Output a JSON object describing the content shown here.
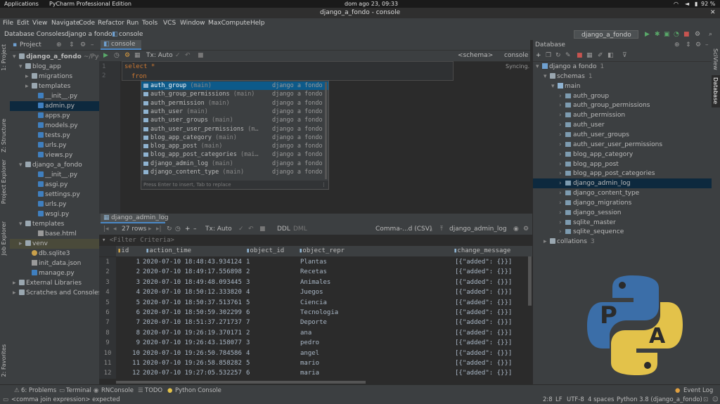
{
  "system": {
    "applications": "Applications",
    "app_name": "PyCharm Professional Edition",
    "clock": "dom ago 23, 09:33",
    "battery": "92 %"
  },
  "window": {
    "title": "django_a_fondo - console"
  },
  "menu": [
    "File",
    "Edit",
    "View",
    "Navigate",
    "Code",
    "Refactor",
    "Run",
    "Tools",
    "VCS",
    "Window",
    "MaxCompute",
    "Help"
  ],
  "breadcrumb": {
    "part1": "Database Consoles",
    "part2": "django a fondo",
    "part3": "console"
  },
  "run_config": "django_a_fondo",
  "project": {
    "header": "Project",
    "items": [
      {
        "label": "django_a_fondo",
        "extra": "~/Pycha",
        "indent": 0,
        "icon": "folder"
      },
      {
        "label": "blog_app",
        "indent": 1,
        "icon": "folder"
      },
      {
        "label": "migrations",
        "indent": 2,
        "icon": "folder"
      },
      {
        "label": "templates",
        "indent": 2,
        "icon": "folder"
      },
      {
        "label": "__init__.py",
        "indent": 3,
        "icon": "py"
      },
      {
        "label": "admin.py",
        "indent": 3,
        "icon": "py",
        "selected": true
      },
      {
        "label": "apps.py",
        "indent": 3,
        "icon": "py"
      },
      {
        "label": "models.py",
        "indent": 3,
        "icon": "py"
      },
      {
        "label": "tests.py",
        "indent": 3,
        "icon": "py"
      },
      {
        "label": "urls.py",
        "indent": 3,
        "icon": "py"
      },
      {
        "label": "views.py",
        "indent": 3,
        "icon": "py"
      },
      {
        "label": "django_a_fondo",
        "indent": 1,
        "icon": "folder"
      },
      {
        "label": "__init__.py",
        "indent": 3,
        "icon": "py"
      },
      {
        "label": "asgi.py",
        "indent": 3,
        "icon": "py"
      },
      {
        "label": "settings.py",
        "indent": 3,
        "icon": "py"
      },
      {
        "label": "urls.py",
        "indent": 3,
        "icon": "py"
      },
      {
        "label": "wsgi.py",
        "indent": 3,
        "icon": "py"
      },
      {
        "label": "templates",
        "indent": 1,
        "icon": "folder"
      },
      {
        "label": "base.html",
        "indent": 3,
        "icon": "file"
      },
      {
        "label": "venv",
        "indent": 1,
        "icon": "folder",
        "venv": true
      },
      {
        "label": "db.sqlite3",
        "indent": 2,
        "icon": "db"
      },
      {
        "label": "init_data.json",
        "indent": 2,
        "icon": "file"
      },
      {
        "label": "manage.py",
        "indent": 2,
        "icon": "py"
      },
      {
        "label": "External Libraries",
        "indent": 0,
        "icon": "folder"
      },
      {
        "label": "Scratches and Consoles",
        "indent": 0,
        "icon": "folder"
      }
    ]
  },
  "left_tabs": {
    "project": "1: Project",
    "structure": "Z: Structure",
    "project_explorer": "Project Explorer",
    "job_explorer": "Job Explorer",
    "favorites": "2: Favorites"
  },
  "editor": {
    "tab": "console",
    "tx": "Tx: Auto",
    "schema": "<schema>",
    "console": "console",
    "syncing": "Syncing...",
    "lines": [
      {
        "num": "1",
        "text": "select *"
      },
      {
        "num": "2",
        "text": "fron"
      }
    ]
  },
  "completion": {
    "items": [
      {
        "name": "auth_group",
        "schema": "(main)",
        "source": "django a fondo"
      },
      {
        "name": "auth_group_permissions",
        "schema": "(main)",
        "source": "django a fondo"
      },
      {
        "name": "auth_permission",
        "schema": "(main)",
        "source": "django a fondo"
      },
      {
        "name": "auth_user",
        "schema": "(main)",
        "source": "django a fondo"
      },
      {
        "name": "auth_user_groups",
        "schema": "(main)",
        "source": "django a fondo"
      },
      {
        "name": "auth_user_user_permissions",
        "schema": "(m…",
        "source": "django a fondo"
      },
      {
        "name": "blog_app_category",
        "schema": "(main)",
        "source": "django a fondo"
      },
      {
        "name": "blog_app_post",
        "schema": "(main)",
        "source": "django a fondo"
      },
      {
        "name": "blog_app_post_categories",
        "schema": "(mai…",
        "source": "django a fondo"
      },
      {
        "name": "django_admin_log",
        "schema": "(main)",
        "source": "django a fondo"
      },
      {
        "name": "django_content_type",
        "schema": "(main)",
        "source": "django a fondo"
      }
    ],
    "hint": "Press Enter to insert, Tab to replace"
  },
  "database": {
    "header": "Database",
    "root": "django a fondo",
    "root_count": "1",
    "schemas": "schemas",
    "schemas_count": "1",
    "main": "main",
    "tables": [
      "auth_group",
      "auth_group_permissions",
      "auth_permission",
      "auth_user",
      "auth_user_groups",
      "auth_user_user_permissions",
      "blog_app_category",
      "blog_app_post",
      "blog_app_post_categories",
      "django_admin_log",
      "django_content_type",
      "django_migrations",
      "django_session",
      "sqlite_master",
      "sqlite_sequence"
    ],
    "collations": "collations",
    "collations_count": "3"
  },
  "right_tabs": {
    "sciview": "SciView",
    "database": "Database"
  },
  "results": {
    "tab": "django_admin_log",
    "rows_label": "27 rows",
    "tx": "Tx: Auto",
    "ddl": "DDL",
    "dml": "DML",
    "format": "Comma-...d (CSV)",
    "table_ref": "django_admin_log",
    "filter": "<Filter Criteria>",
    "columns": [
      "id",
      "action_time",
      "object_id",
      "object_repr",
      "change_message"
    ],
    "rows": [
      [
        "1",
        "2020-07-10 18:48:43.934124",
        "1",
        "Plantas",
        "[{\"added\": {}}]"
      ],
      [
        "2",
        "2020-07-10 18:49:17.556898",
        "2",
        "Recetas",
        "[{\"added\": {}}]"
      ],
      [
        "3",
        "2020-07-10 18:49:48.093445",
        "3",
        "Animales",
        "[{\"added\": {}}]"
      ],
      [
        "4",
        "2020-07-10 18:50:12.333820",
        "4",
        "Juegos",
        "[{\"added\": {}}]"
      ],
      [
        "5",
        "2020-07-10 18:50:37.513761",
        "5",
        "Ciencia",
        "[{\"added\": {}}]"
      ],
      [
        "6",
        "2020-07-10 18:50:59.302299",
        "6",
        "Tecnologia",
        "[{\"added\": {}}]"
      ],
      [
        "7",
        "2020-07-10 18:51:37.271737",
        "7",
        "Deporte",
        "[{\"added\": {}}]"
      ],
      [
        "8",
        "2020-07-10 19:26:19.370171",
        "2",
        "ana",
        "[{\"added\": {}}]"
      ],
      [
        "9",
        "2020-07-10 19:26:43.158077",
        "3",
        "pedro",
        "[{\"added\": {}}]"
      ],
      [
        "10",
        "2020-07-10 19:26:50.784586",
        "4",
        "angel",
        "[{\"added\": {}}]"
      ],
      [
        "11",
        "2020-07-10 19:26:58.858282",
        "5",
        "mario",
        "[{\"added\": {}}]"
      ],
      [
        "12",
        "2020-07-10 19:27:05.532257",
        "6",
        "maria",
        "[{\"added\": {}}]"
      ]
    ]
  },
  "bottom_tabs": {
    "problems": "6: Problems",
    "terminal": "Terminal",
    "rnconsole": "RNConsole",
    "todo": "TODO",
    "pyconsole": "Python Console",
    "eventlog": "Event Log"
  },
  "status": {
    "message": "<comma join expression> expected",
    "position": "2:8",
    "lf": "LF",
    "encoding": "UTF-8",
    "indent": "4 spaces",
    "interpreter": "Python 3.8 (django_a_fondo)"
  },
  "colors": {
    "keyword": "#cc7832",
    "selection": "#0d5a8a",
    "accent_blue": "#3f7fbf",
    "logo_blue": "#3b6ea8",
    "logo_yellow": "#e3c24a"
  }
}
